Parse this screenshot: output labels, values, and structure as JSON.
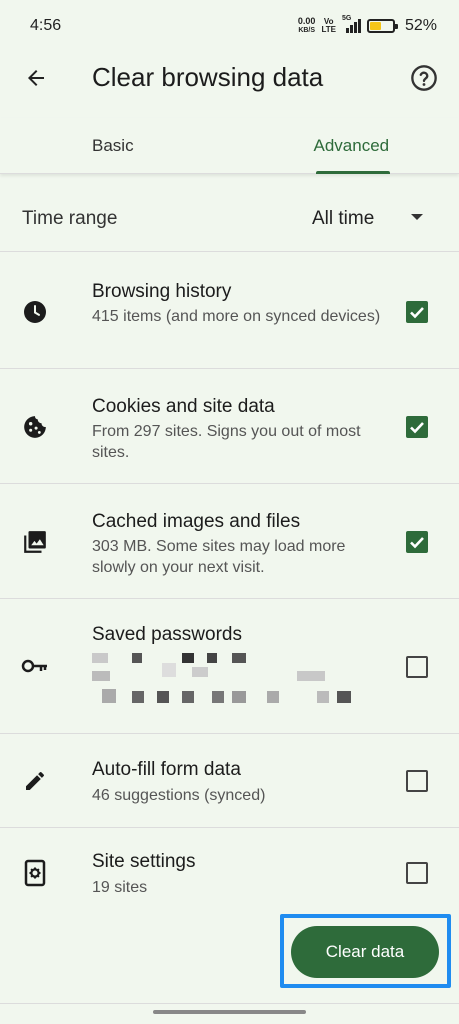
{
  "status_bar": {
    "time": "4:56",
    "net_speed_value": "0.00",
    "net_speed_unit": "KB/S",
    "volte_top": "Vo",
    "volte_bottom": "LTE",
    "network": "5G",
    "battery_percent": "52%",
    "battery_level": 0.52
  },
  "toolbar": {
    "title": "Clear browsing data"
  },
  "tabs": [
    {
      "label": "Basic",
      "selected": false
    },
    {
      "label": "Advanced",
      "selected": true
    }
  ],
  "time_range": {
    "label": "Time range",
    "value": "All time"
  },
  "items": [
    {
      "icon": "clock-icon",
      "title": "Browsing history",
      "subtitle": "415 items (and more on synced devices)",
      "checked": true
    },
    {
      "icon": "cookie-icon",
      "title": "Cookies and site data",
      "subtitle": "From 297 sites. Signs you out of most sites.",
      "checked": true
    },
    {
      "icon": "image-stack-icon",
      "title": "Cached images and files",
      "subtitle": "303 MB. Some sites may load more slowly on your next visit.",
      "checked": true
    },
    {
      "icon": "key-icon",
      "title": "Saved passwords",
      "subtitle": "",
      "checked": false
    },
    {
      "icon": "pencil-icon",
      "title": "Auto-fill form data",
      "subtitle": "46 suggestions (synced)",
      "checked": false
    },
    {
      "icon": "site-settings-icon",
      "title": "Site settings",
      "subtitle": "19 sites",
      "checked": false
    }
  ],
  "actions": {
    "clear_data_label": "Clear data"
  },
  "colors": {
    "accent": "#2e6b3a",
    "background": "#f1f7ee",
    "highlight": "#1f8cf0"
  }
}
